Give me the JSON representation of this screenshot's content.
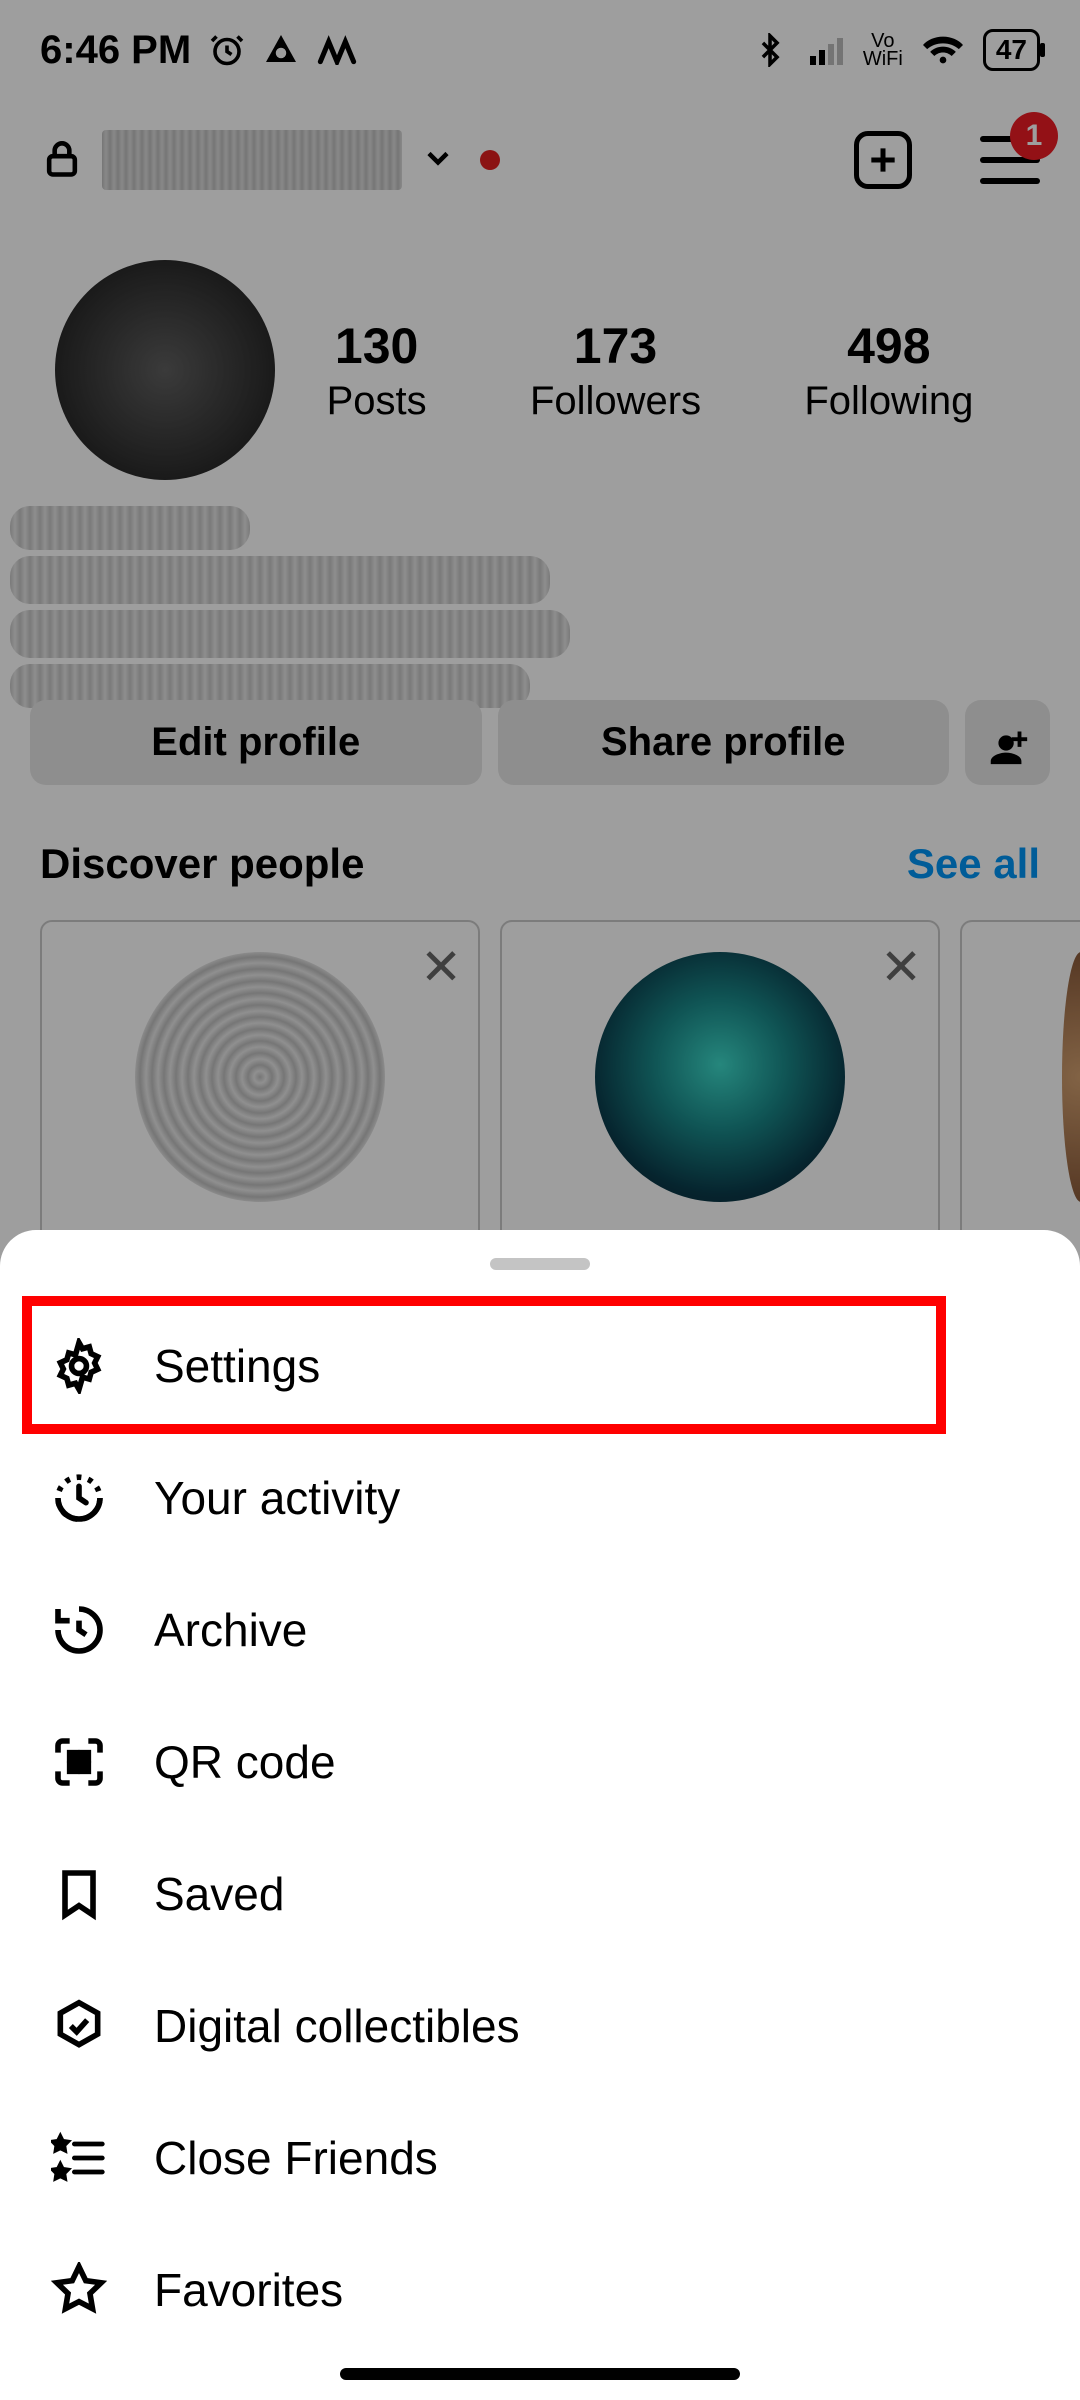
{
  "status": {
    "time": "6:46 PM",
    "battery": "47"
  },
  "header": {
    "badge": "1"
  },
  "stats": {
    "posts_n": "130",
    "posts_lbl": "Posts",
    "followers_n": "173",
    "followers_lbl": "Followers",
    "following_n": "498",
    "following_lbl": "Following"
  },
  "buttons": {
    "edit": "Edit profile",
    "share": "Share profile"
  },
  "discover": {
    "title": "Discover people",
    "see_all": "See all"
  },
  "menu": {
    "settings": "Settings",
    "activity": "Your activity",
    "archive": "Archive",
    "qr": "QR code",
    "saved": "Saved",
    "collectibles": "Digital collectibles",
    "close_friends": "Close Friends",
    "favorites": "Favorites"
  }
}
